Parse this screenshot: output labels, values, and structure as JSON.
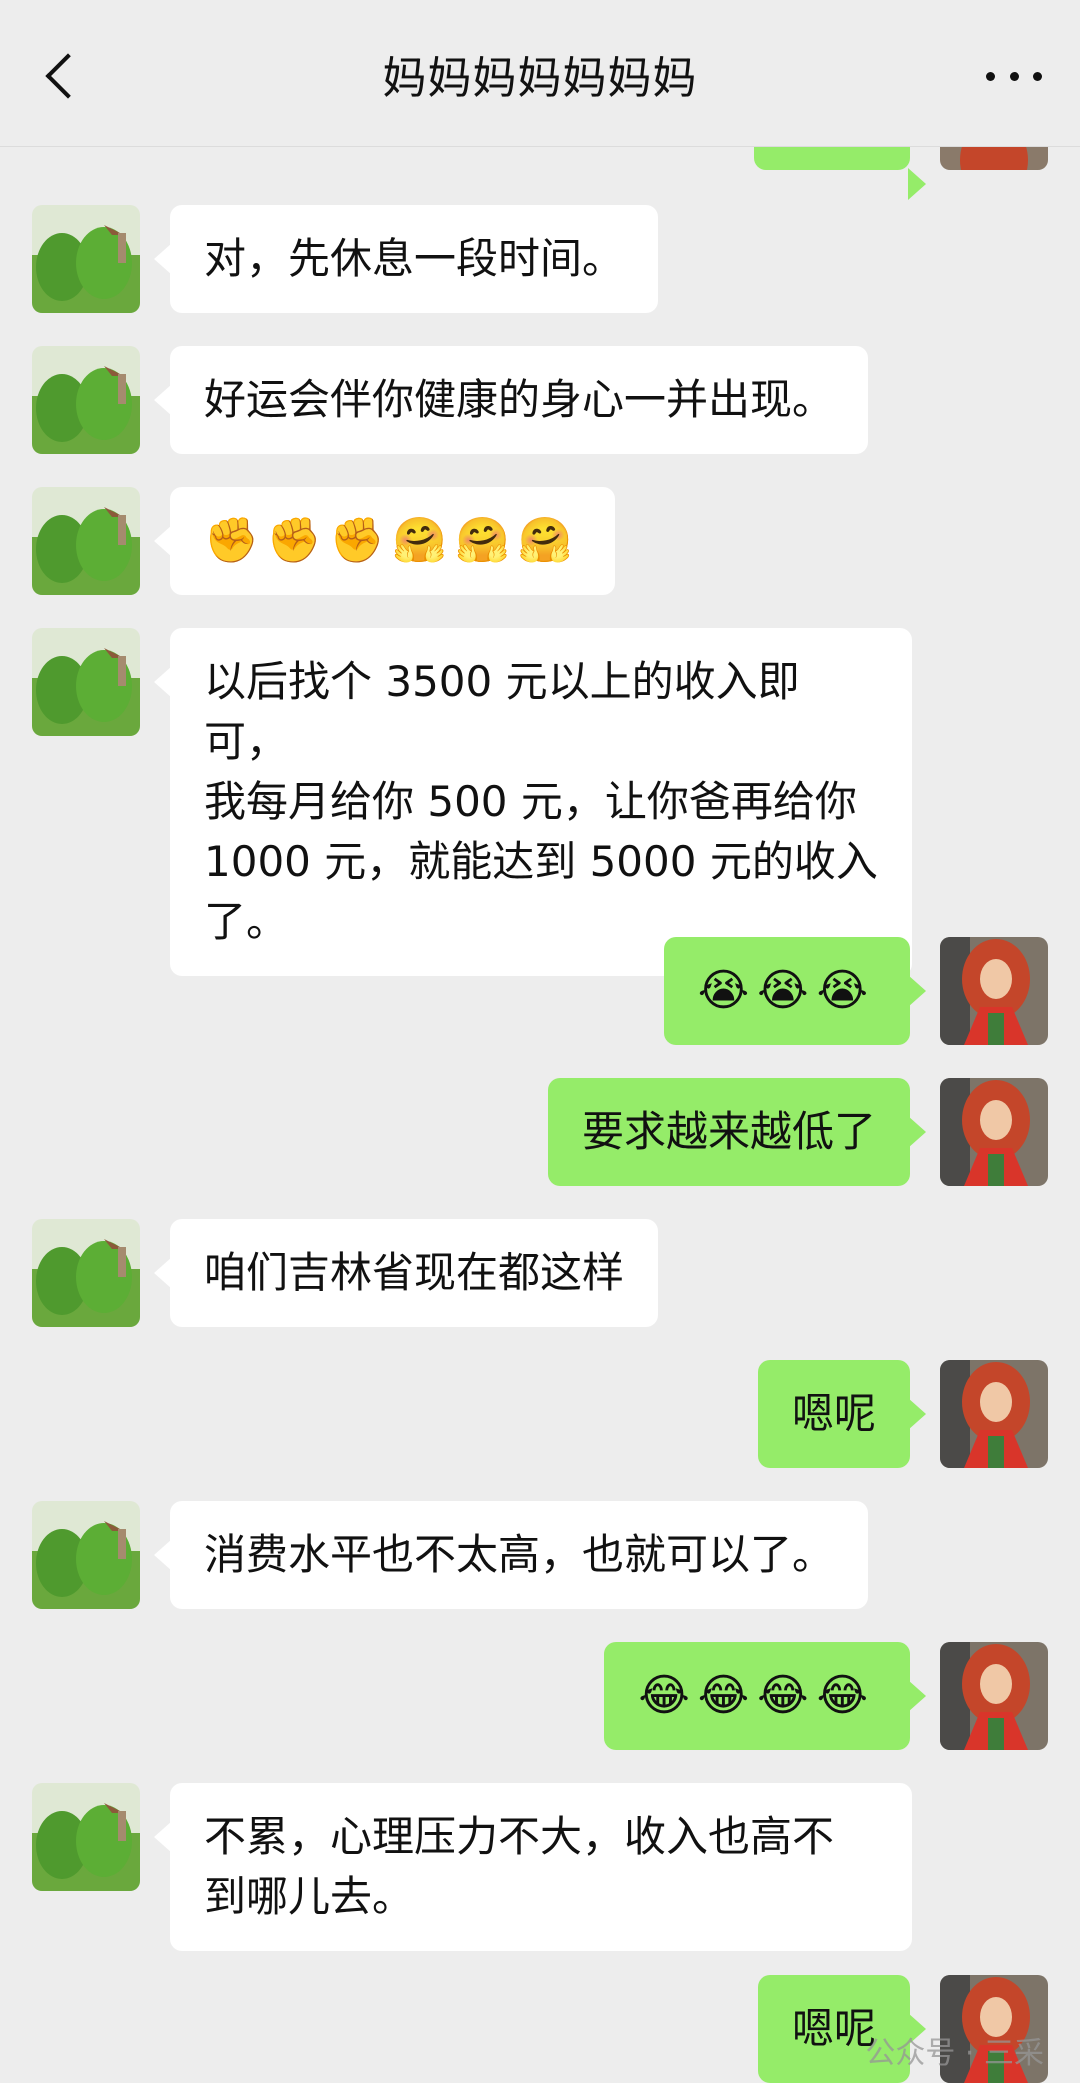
{
  "header": {
    "title": "妈妈妈妈妈妈妈"
  },
  "messages": [
    {
      "from": "mom",
      "text": "对，先休息一段时间。"
    },
    {
      "from": "mom",
      "text": "好运会伴你健康的身心一并出现。"
    },
    {
      "from": "mom",
      "text": "✊✊✊🤗🤗🤗"
    },
    {
      "from": "mom",
      "text": "以后找个 3500 元以上的收入即可，\n我每月给你 500 元，让你爸再给你\n1000 元，就能达到 5000 元的收入\n了。"
    },
    {
      "from": "me",
      "text": "😭😭😭"
    },
    {
      "from": "me",
      "text": "要求越来越低了"
    },
    {
      "from": "mom",
      "text": "咱们吉林省现在都这样"
    },
    {
      "from": "me",
      "text": "嗯呢"
    },
    {
      "from": "mom",
      "text": "消费水平也不太高，也就可以了。"
    },
    {
      "from": "me",
      "text": "😂😂😂😂"
    },
    {
      "from": "mom",
      "text": "不累，心理压力不大，收入也高不\n到哪儿去。"
    },
    {
      "from": "me",
      "text": "嗯呢"
    }
  ],
  "watermark": "公众号 · 三采"
}
